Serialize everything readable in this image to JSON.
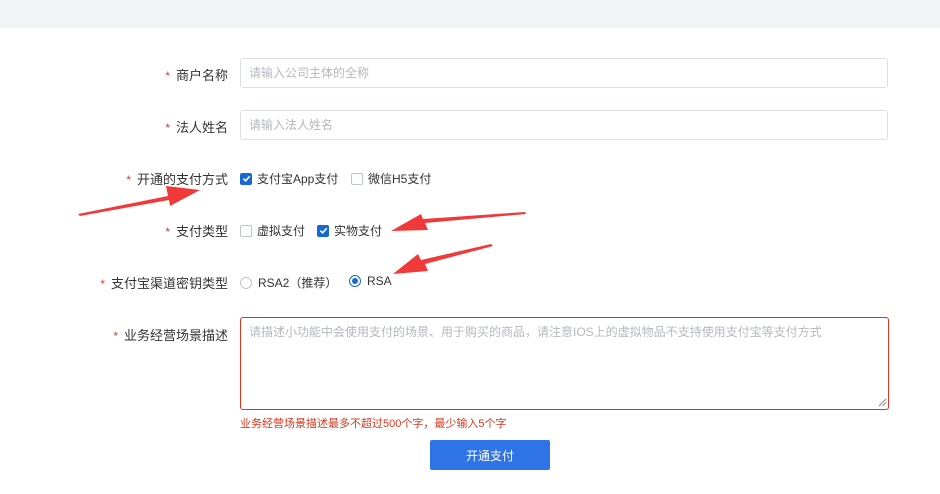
{
  "form": {
    "merchant_name": {
      "required_mark": "*",
      "label": "商户名称",
      "placeholder": "请输入公司主体的全称",
      "value": ""
    },
    "legal_person": {
      "required_mark": "*",
      "label": "法人姓名",
      "placeholder": "请输入法人姓名",
      "value": ""
    },
    "payment_methods": {
      "required_mark": "*",
      "label": "开通的支付方式",
      "options": [
        {
          "label": "支付宝App支付",
          "checked": true
        },
        {
          "label": "微信H5支付",
          "checked": false
        }
      ]
    },
    "payment_type": {
      "required_mark": "*",
      "label": "支付类型",
      "options": [
        {
          "label": "虚拟支付",
          "checked": false
        },
        {
          "label": "实物支付",
          "checked": true
        }
      ]
    },
    "key_type": {
      "required_mark": "*",
      "label": "支付宝渠道密钥类型",
      "options": [
        {
          "label": "RSA2（推荐）",
          "selected": false
        },
        {
          "label": "RSA",
          "selected": true
        }
      ]
    },
    "scenario": {
      "required_mark": "*",
      "label": "业务经营场景描述",
      "placeholder": "请描述小功能中会使用支付的场景、用于购买的商品，请注意IOS上的虚拟物品不支持使用支付宝等支付方式",
      "value": "",
      "error": "业务经营场景描述最多不超过500个字，最少输入5个字"
    },
    "submit_label": "开通支付"
  },
  "colors": {
    "accent": "#1967d2",
    "button": "#2f74e6",
    "error": "#d9361c",
    "required": "#e53935",
    "annotation_arrow": "#f03a3a"
  }
}
